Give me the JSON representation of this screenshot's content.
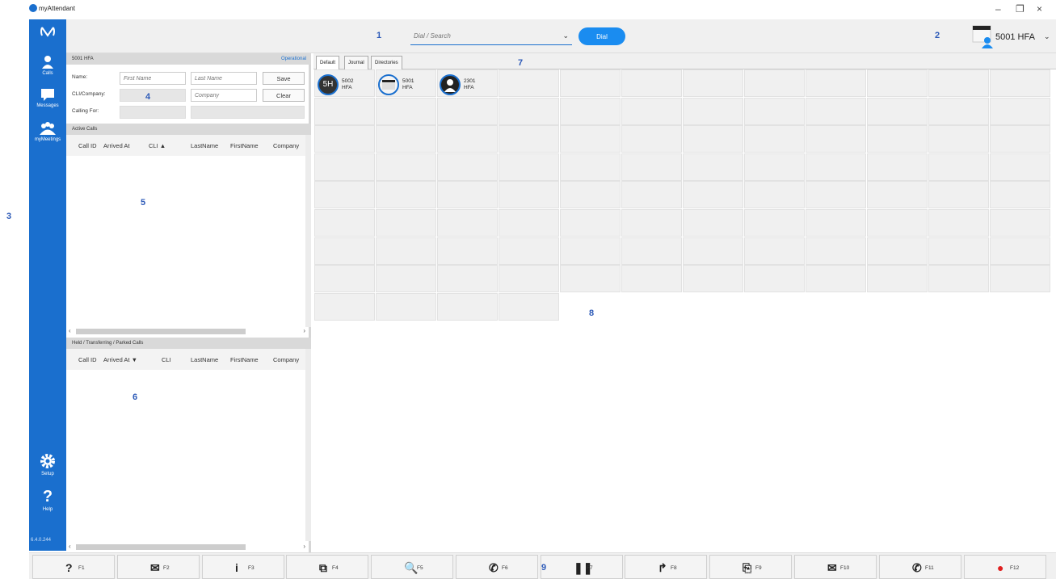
{
  "app": {
    "title": "myAttendant"
  },
  "window": {
    "minimize": "–",
    "restore": "❐",
    "close": "×"
  },
  "markers": [
    "1",
    "2",
    "3",
    "4",
    "5",
    "6",
    "7",
    "8",
    "9"
  ],
  "sidebar": {
    "items": [
      {
        "label": "Calls",
        "icon": "calls-icon"
      },
      {
        "label": "Messages",
        "icon": "messages-icon"
      },
      {
        "label": "myMeetings",
        "icon": "meetings-icon"
      },
      {
        "label": "Setup",
        "icon": "gear-icon"
      },
      {
        "label": "Help",
        "icon": "help-icon"
      }
    ],
    "version": "6.4.0.244"
  },
  "topbar": {
    "search_placeholder": "Dial / Search",
    "dial_label": "Dial",
    "user_label": "5001 HFA"
  },
  "caller": {
    "header_title": "5001 HFA",
    "status": "Operational",
    "name_label": "Name:",
    "cli_label": "CLI/Company:",
    "calling_for_label": "Calling For:",
    "first_name_placeholder": "First Name",
    "last_name_placeholder": "Last Name",
    "company_placeholder": "Company",
    "save_label": "Save",
    "clear_label": "Clear"
  },
  "active_calls": {
    "header": "Active Calls",
    "columns": [
      "Call ID",
      "Arrived At",
      "CLI ▲",
      "LastName",
      "FirstName",
      "Company"
    ]
  },
  "held_calls": {
    "header": "Held / Transferring / Parked Calls",
    "columns": [
      "Call ID",
      "Arrived At ▼",
      "CLI",
      "LastName",
      "FirstName",
      "Company"
    ]
  },
  "tabs": [
    "Default",
    "Journal",
    "Directories"
  ],
  "contacts": [
    {
      "avatar": "5H",
      "line1": "5002",
      "line2": "HFA"
    },
    {
      "avatar": "",
      "line1": "5001",
      "line2": "HFA"
    },
    {
      "avatar": "",
      "line1": "2301",
      "line2": "HFA"
    }
  ],
  "fkeys": [
    {
      "icon": "?",
      "label": "F1"
    },
    {
      "icon": "✉",
      "label": "F2"
    },
    {
      "icon": "i",
      "label": "F3"
    },
    {
      "icon": "⧉",
      "label": "F4"
    },
    {
      "icon": "🔍",
      "label": "F5"
    },
    {
      "icon": "✆",
      "label": "F6"
    },
    {
      "icon": "❚❚",
      "label": "F7"
    },
    {
      "icon": "↱",
      "label": "F8"
    },
    {
      "icon": "⎘",
      "label": "F9"
    },
    {
      "icon": "✉",
      "label": "F10"
    },
    {
      "icon": "✆",
      "label": "F11"
    },
    {
      "icon": "●",
      "label": "F12"
    }
  ],
  "colors": {
    "brand": "#1a6fce",
    "dial": "#1a8cf0",
    "record": "#e02020"
  }
}
